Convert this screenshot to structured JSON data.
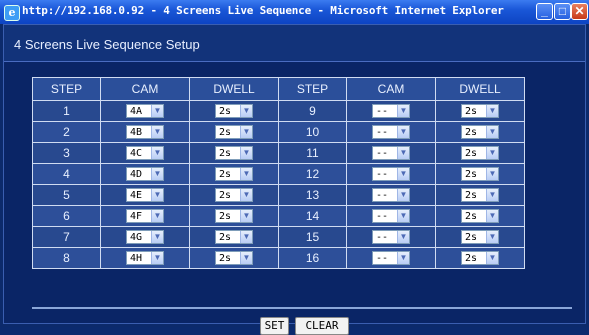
{
  "window": {
    "title": "http://192.168.0.92 - 4 Screens Live Sequence - Microsoft Internet Explorer",
    "icon": "ie-icon",
    "controls": {
      "minimize": "_",
      "maximize": "□",
      "close": "✕"
    }
  },
  "page": {
    "heading": "4 Screens Live Sequence Setup"
  },
  "table": {
    "headers": {
      "step": "STEP",
      "cam": "CAM",
      "dwell": "DWELL"
    },
    "rows": [
      {
        "left": {
          "step": "1",
          "cam": "4A",
          "dwell": "2s"
        },
        "right": {
          "step": "9",
          "cam": "--",
          "dwell": "2s"
        }
      },
      {
        "left": {
          "step": "2",
          "cam": "4B",
          "dwell": "2s"
        },
        "right": {
          "step": "10",
          "cam": "--",
          "dwell": "2s"
        }
      },
      {
        "left": {
          "step": "3",
          "cam": "4C",
          "dwell": "2s"
        },
        "right": {
          "step": "11",
          "cam": "--",
          "dwell": "2s"
        }
      },
      {
        "left": {
          "step": "4",
          "cam": "4D",
          "dwell": "2s"
        },
        "right": {
          "step": "12",
          "cam": "--",
          "dwell": "2s"
        }
      },
      {
        "left": {
          "step": "5",
          "cam": "4E",
          "dwell": "2s"
        },
        "right": {
          "step": "13",
          "cam": "--",
          "dwell": "2s"
        }
      },
      {
        "left": {
          "step": "6",
          "cam": "4F",
          "dwell": "2s"
        },
        "right": {
          "step": "14",
          "cam": "--",
          "dwell": "2s"
        }
      },
      {
        "left": {
          "step": "7",
          "cam": "4G",
          "dwell": "2s"
        },
        "right": {
          "step": "15",
          "cam": "--",
          "dwell": "2s"
        }
      },
      {
        "left": {
          "step": "8",
          "cam": "4H",
          "dwell": "2s"
        },
        "right": {
          "step": "16",
          "cam": "--",
          "dwell": "2s"
        }
      }
    ]
  },
  "buttons": {
    "set": "SET",
    "clear": "CLEAR"
  },
  "icons": {
    "dropdown": "chevron-down-icon"
  },
  "colors": {
    "background": "#0c2a6b",
    "titlebar": "#1a57d8",
    "table_cell": "#2d4f99",
    "border": "#d0dcf2"
  }
}
